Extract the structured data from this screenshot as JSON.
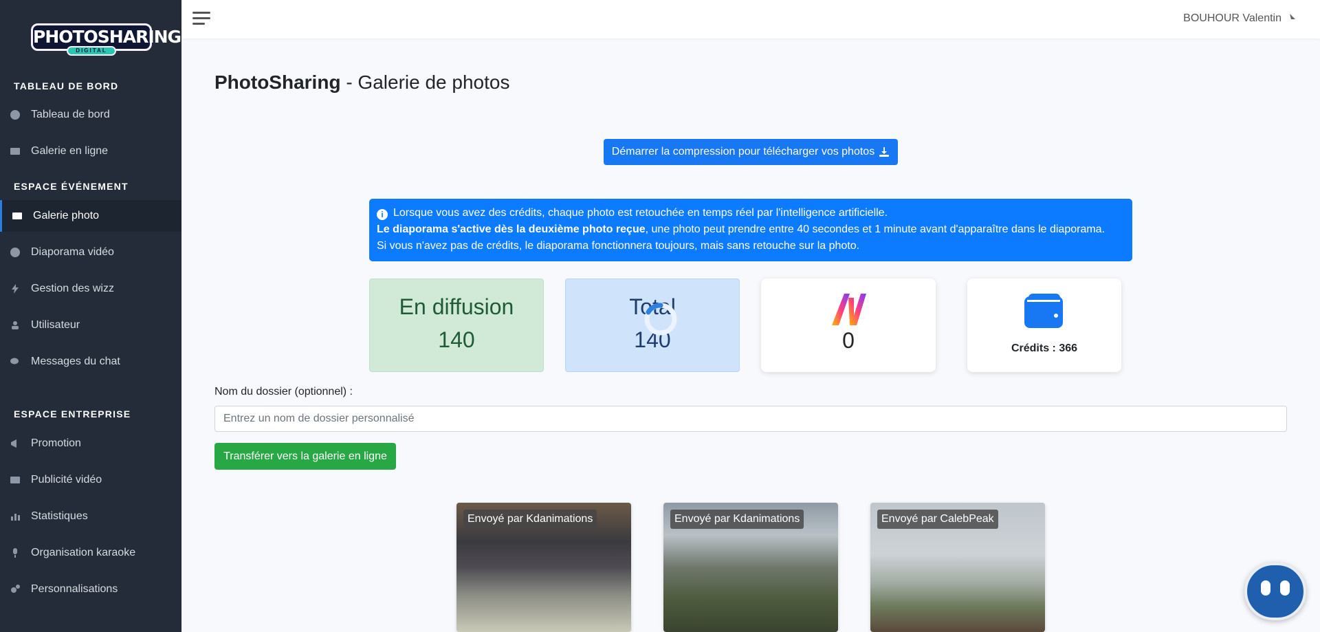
{
  "app": {
    "logo_text": "PHOTOSHARING",
    "logo_sub": "DIGITAL"
  },
  "sidebar": {
    "sections": [
      {
        "title": "TABLEAU DE BORD",
        "items": [
          "Tableau de bord",
          "Galerie en ligne"
        ]
      },
      {
        "title": "ESPACE ÉVÉNEMENT",
        "items": [
          "Galerie photo",
          "Diaporama vidéo",
          "Gestion des wizz",
          "Utilisateur",
          "Messages du chat"
        ]
      },
      {
        "title": "ESPACE ENTREPRISE",
        "items": [
          "Promotion",
          "Publicité vidéo",
          "Statistiques",
          "Organisation karaoke",
          "Personnalisations"
        ]
      }
    ],
    "active_item": "Galerie photo"
  },
  "topbar": {
    "user_name": "BOUHOUR Valentin"
  },
  "page": {
    "title_bold": "PhotoSharing",
    "title_rest": " - Galerie de photos"
  },
  "download_button": "Démarrer la compression pour télécharger vos photos",
  "alert": {
    "line1": "Lorsque vous avez des crédits, chaque photo est retouchée en temps réel par l'intelligence artificielle.",
    "line2_bold": "Le diaporama s'active dès la deuxième photo reçue",
    "line2_rest": ", une photo peut prendre entre 40 secondes et 1 minute avant d'apparaître dans le diaporama.",
    "line3": "Si vous n'avez pas de crédits, le diaporama fonctionnera toujours, mais sans retouche sur la photo."
  },
  "stats": {
    "diffusion_label": "En diffusion",
    "diffusion_value": "140",
    "total_label": "Total",
    "total_value": "140",
    "ai_value": "0",
    "credits_text": "Crédits : 366"
  },
  "folder": {
    "label": "Nom du dossier (optionnel) :",
    "placeholder": "Entrez un nom de dossier personnalisé",
    "value": ""
  },
  "transfer_button": "Transférer vers la galerie en ligne",
  "photos": [
    {
      "caption": "Envoyé par Kdanimations"
    },
    {
      "caption": "Envoyé par Kdanimations"
    },
    {
      "caption": "Envoyé par CalebPeak"
    }
  ],
  "colors": {
    "sidebar_bg": "#232c38",
    "primary": "#1877f2",
    "success": "#28a745",
    "alert_bg": "#0d7bff"
  },
  "icons": {
    "menu": "hamburger-icon",
    "download": "download-icon",
    "info": "info-icon",
    "wallet": "wallet-icon",
    "ai": "ai-logo-icon",
    "chatbot": "chatbot-icon"
  }
}
